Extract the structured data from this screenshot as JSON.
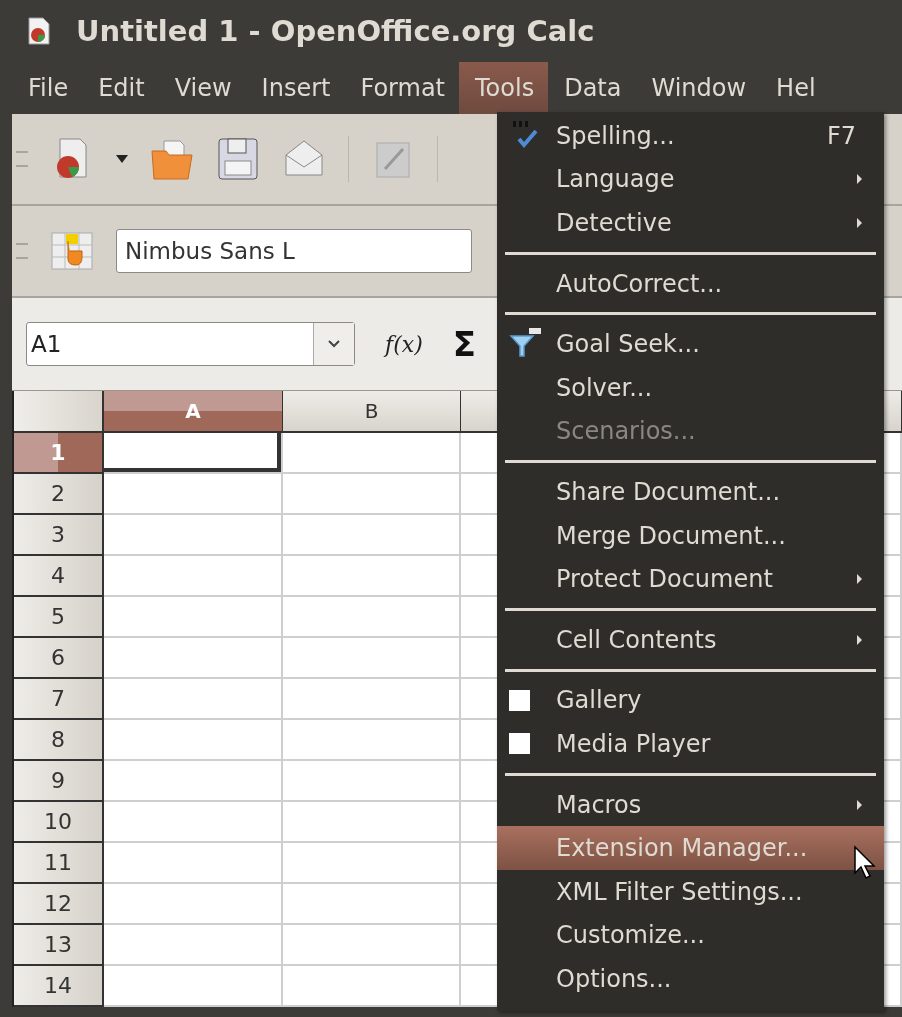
{
  "window": {
    "title": "Untitled 1 - OpenOffice.org Calc"
  },
  "menu_bar": [
    {
      "label": "File",
      "selected": false
    },
    {
      "label": "Edit",
      "selected": false
    },
    {
      "label": "View",
      "selected": false
    },
    {
      "label": "Insert",
      "selected": false
    },
    {
      "label": "Format",
      "selected": false
    },
    {
      "label": "Tools",
      "selected": true
    },
    {
      "label": "Data",
      "selected": false
    },
    {
      "label": "Window",
      "selected": false
    },
    {
      "label": "Hel",
      "selected": false
    }
  ],
  "formatting_toolbar": {
    "font_name": "Nimbus Sans L"
  },
  "formula_bar": {
    "name_box": "A1",
    "function_label": "f(x)",
    "sum_label": "Σ"
  },
  "sheet": {
    "columns": [
      {
        "label": "A",
        "selected": true
      },
      {
        "label": "B",
        "selected": false
      }
    ],
    "rows": [
      {
        "label": "1",
        "selected": true
      },
      {
        "label": "2",
        "selected": false
      },
      {
        "label": "3",
        "selected": false
      },
      {
        "label": "4",
        "selected": false
      },
      {
        "label": "5",
        "selected": false
      },
      {
        "label": "6",
        "selected": false
      },
      {
        "label": "7",
        "selected": false
      },
      {
        "label": "8",
        "selected": false
      },
      {
        "label": "9",
        "selected": false
      },
      {
        "label": "10",
        "selected": false
      },
      {
        "label": "11",
        "selected": false
      },
      {
        "label": "12",
        "selected": false
      },
      {
        "label": "13",
        "selected": false
      },
      {
        "label": "14",
        "selected": false
      }
    ]
  },
  "tools_menu": {
    "items": [
      {
        "kind": "item",
        "label": "Spelling...",
        "shortcut": "F7",
        "submenu": false,
        "disabled": false,
        "selected": false
      },
      {
        "kind": "item",
        "label": "Language",
        "submenu": true,
        "disabled": false,
        "selected": false
      },
      {
        "kind": "item",
        "label": "Detective",
        "submenu": true,
        "disabled": false,
        "selected": false
      },
      {
        "kind": "separator"
      },
      {
        "kind": "item",
        "label": "AutoCorrect...",
        "submenu": false,
        "disabled": false,
        "selected": false
      },
      {
        "kind": "separator"
      },
      {
        "kind": "item",
        "label": "Goal Seek...",
        "submenu": false,
        "disabled": false,
        "selected": false
      },
      {
        "kind": "item",
        "label": "Solver...",
        "submenu": false,
        "disabled": false,
        "selected": false
      },
      {
        "kind": "item",
        "label": "Scenarios...",
        "submenu": false,
        "disabled": true,
        "selected": false
      },
      {
        "kind": "separator"
      },
      {
        "kind": "item",
        "label": "Share Document...",
        "submenu": false,
        "disabled": false,
        "selected": false
      },
      {
        "kind": "item",
        "label": "Merge Document...",
        "submenu": false,
        "disabled": false,
        "selected": false
      },
      {
        "kind": "item",
        "label": "Protect Document",
        "submenu": true,
        "disabled": false,
        "selected": false
      },
      {
        "kind": "separator"
      },
      {
        "kind": "item",
        "label": "Cell Contents",
        "submenu": true,
        "disabled": false,
        "selected": false
      },
      {
        "kind": "separator"
      },
      {
        "kind": "checkbox",
        "label": "Gallery",
        "checked": false,
        "selected": false
      },
      {
        "kind": "checkbox",
        "label": "Media Player",
        "checked": false,
        "selected": false
      },
      {
        "kind": "separator"
      },
      {
        "kind": "item",
        "label": "Macros",
        "submenu": true,
        "disabled": false,
        "selected": false
      },
      {
        "kind": "item",
        "label": "Extension Manager...",
        "submenu": false,
        "disabled": false,
        "selected": true
      },
      {
        "kind": "item",
        "label": "XML Filter Settings...",
        "submenu": false,
        "disabled": false,
        "selected": false
      },
      {
        "kind": "item",
        "label": "Customize...",
        "submenu": false,
        "disabled": false,
        "selected": false
      },
      {
        "kind": "item",
        "label": "Options...",
        "submenu": false,
        "disabled": false,
        "selected": false
      }
    ]
  }
}
